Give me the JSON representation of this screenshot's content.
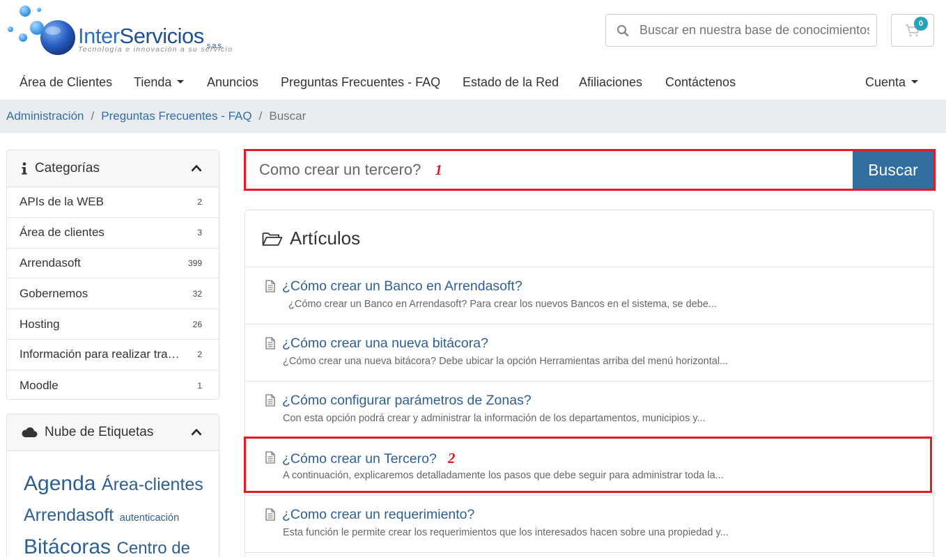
{
  "brand": {
    "name_part1": "Inter",
    "name_part2": "Servicios",
    "suffix": "s.a.s.",
    "tagline": "Tecnología e innovación a su servicio"
  },
  "header": {
    "search_placeholder": "Buscar en nuestra base de conocimientos...",
    "cart_count": "0"
  },
  "nav": {
    "items": [
      "Área de Clientes",
      "Tienda",
      "Anuncios",
      "Preguntas Frecuentes - FAQ",
      "Estado de la Red",
      "Afiliaciones",
      "Contáctenos"
    ],
    "account": "Cuenta"
  },
  "breadcrumb": {
    "items": [
      "Administración",
      "Preguntas Frecuentes - FAQ"
    ],
    "current": "Buscar"
  },
  "categories": {
    "title": "Categorías",
    "items": [
      {
        "label": "APIs de la WEB",
        "count": "2"
      },
      {
        "label": "Área de clientes",
        "count": "3"
      },
      {
        "label": "Arrendasoft",
        "count": "399"
      },
      {
        "label": "Gobernemos",
        "count": "32"
      },
      {
        "label": "Hosting",
        "count": "26"
      },
      {
        "label": "Información para realizar transferencias",
        "count": "2"
      },
      {
        "label": "Moodle",
        "count": "1"
      }
    ]
  },
  "tag_cloud": {
    "title": "Nube de Etiquetas",
    "tags": [
      "Agenda",
      "Área-clientes",
      "Arrendasoft",
      "autenticación",
      "Bitácoras",
      "Centro de"
    ]
  },
  "search": {
    "query": "Como crear un tercero?",
    "button": "Buscar",
    "marker": "1"
  },
  "articles": {
    "title": "Artículos",
    "items": [
      {
        "title": "¿Cómo crear un Banco en Arrendasoft?",
        "desc": "¿Cómo crear un Banco en Arrendasoft? Para crear los nuevos Bancos en el sistema, se debe..."
      },
      {
        "title": "¿Cómo crear una nueva bitácora?",
        "desc": "¿Cómo crear una nueva bitácora? Debe ubicar la opción Herramientas arriba del menú horizontal..."
      },
      {
        "title": "¿Cómo configurar parámetros de Zonas?",
        "desc": "Con esta opción podrá crear y administrar la información de los departamentos, municipios y..."
      },
      {
        "title": "¿Cómo crear un Tercero?",
        "desc": "A continuación, explicaremos detalladamente los pasos que debe seguir para administrar toda la..."
      },
      {
        "title": "¿Como crear un requerimiento?",
        "desc": "Esta función le permite crear los requerimientos que los interesados hacen sobre una propiedad y..."
      }
    ],
    "marker": "2"
  },
  "colors": {
    "link": "#2d5f93",
    "button": "#336ea1",
    "highlight": "#e01b24",
    "badge": "#26a3b8"
  }
}
